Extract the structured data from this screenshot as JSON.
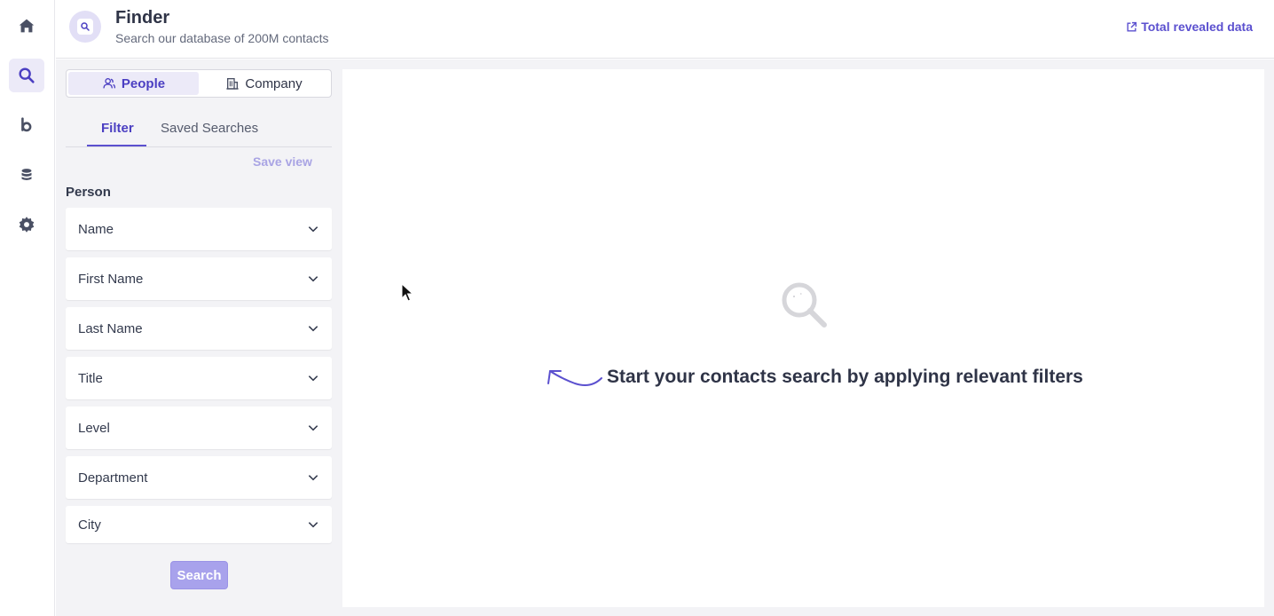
{
  "header": {
    "title": "Finder",
    "subtitle": "Search our database of 200M contacts",
    "link_label": "Total revealed data",
    "link_icon": "external-link-icon"
  },
  "rail": {
    "items": [
      {
        "icon": "home-icon",
        "active": false
      },
      {
        "icon": "search-icon",
        "active": true
      },
      {
        "icon": "brand-b-icon",
        "active": false
      },
      {
        "icon": "database-icon",
        "active": false
      },
      {
        "icon": "gear-icon",
        "active": false
      }
    ]
  },
  "filters": {
    "segments": [
      {
        "label": "People",
        "icon": "people-icon",
        "active": true
      },
      {
        "label": "Company",
        "icon": "building-icon",
        "active": false
      }
    ],
    "tabs": [
      {
        "label": "Filter",
        "active": true
      },
      {
        "label": "Saved Searches",
        "active": false
      }
    ],
    "save_view_label": "Save view",
    "section_label": "Person",
    "rows": [
      "Name",
      "First Name",
      "Last Name",
      "Title",
      "Level",
      "Department",
      "City"
    ],
    "search_label": "Search"
  },
  "results": {
    "empty_message": "Start your contacts search by applying relevant filters",
    "empty_icon": "magnifier-icon"
  },
  "colors": {
    "accent": "#5b50cf",
    "accent_light": "#eceaf8",
    "search_button": "#a8a2ec",
    "text": "#2f3447"
  }
}
